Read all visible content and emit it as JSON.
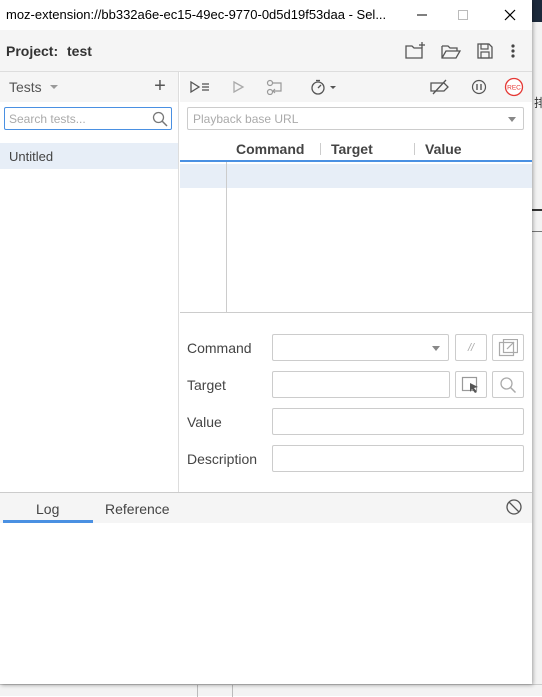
{
  "window": {
    "title": "moz-extension://bb332a6e-ec15-49ec-9770-0d5d19f53daa - Sel..."
  },
  "project": {
    "label": "Project:",
    "name": "test"
  },
  "tests_panel": {
    "dropdown_label": "Tests",
    "search_placeholder": "Search tests...",
    "tests": [
      "Untitled"
    ]
  },
  "playback": {
    "base_url_placeholder": "Playback base URL",
    "record_label": "REC"
  },
  "table": {
    "columns": [
      "Command",
      "Target",
      "Value"
    ]
  },
  "editor": {
    "command_label": "Command",
    "target_label": "Target",
    "value_label": "Value",
    "description_label": "Description",
    "comment_toggle": "//"
  },
  "console": {
    "tabs": [
      "Log",
      "Reference"
    ],
    "active_tab": "Log"
  },
  "background": {
    "glyph": "排"
  },
  "colors": {
    "accent": "#4a90e2",
    "record": "#e53935",
    "selected_row": "#e7eef7"
  }
}
